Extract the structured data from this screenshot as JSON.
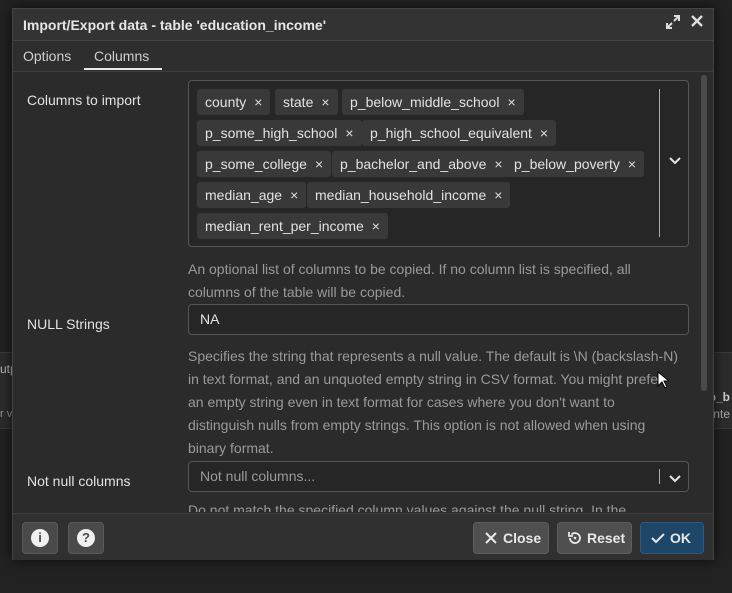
{
  "background": {
    "left_text_1": "utp",
    "left_text_2": "r v",
    "right_text_1": "p_b",
    "right_text_2": "inte"
  },
  "dialog": {
    "title": "Import/Export data - table 'education_income'",
    "tabs": [
      "Options",
      "Columns"
    ],
    "active_tab": "Columns",
    "columns_to_import": {
      "label": "Columns to import",
      "chips": [
        "county",
        "state",
        "p_below_middle_school",
        "p_some_high_school",
        "p_high_school_equivalent",
        "p_some_college",
        "p_bachelor_and_above",
        "p_below_poverty",
        "median_age",
        "median_household_income",
        "median_rent_per_income"
      ],
      "help": "An optional list of columns to be copied. If no column list is specified, all columns of the table will be copied."
    },
    "null_strings": {
      "label": "NULL Strings",
      "value": "NA",
      "help": "Specifies the string that represents a null value. The default is \\N (backslash-N) in text format, and an unquoted empty string in CSV format. You might prefer an empty string even in text format for cases where you don't want to distinguish nulls from empty strings. This option is not allowed when using binary format."
    },
    "not_null_columns": {
      "label": "Not null columns",
      "placeholder": "Not null columns...",
      "help": "Do not match the specified column values against the null string. In the"
    },
    "footer": {
      "info_label": "i",
      "help_label": "?",
      "close_label": "Close",
      "reset_label": "Reset",
      "ok_label": "OK"
    }
  },
  "colors": {
    "dialog_bg": "#2b2b2b",
    "primary": "#1d4668",
    "chip_bg": "#393939"
  }
}
